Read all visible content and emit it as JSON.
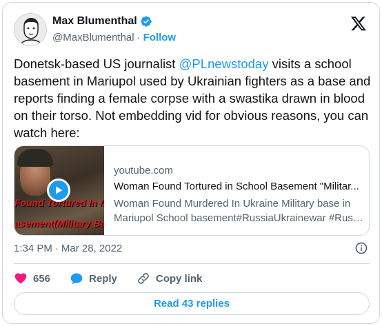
{
  "author": {
    "name": "Max Blumenthal",
    "handle": "@MaxBlumenthal",
    "separator": "·",
    "follow_label": "Follow"
  },
  "tweet": {
    "text_before": "Donetsk-based US journalist ",
    "mention": "@PLnewstoday",
    "text_after": " visits a school basement in Mariupol used by Ukrainian fighters as a base and reports finding a female corpse with a swastika drawn in blood on their torso. Not embedding vid for obvious reasons, you can watch here:"
  },
  "link_card": {
    "domain": "youtube.com",
    "title": "Woman Found Tortured in School Basement \"Militar...",
    "description_line1": "Woman Found Murdered In Ukraine Military base in",
    "description_line2": "Mariupol School basement#RussiaUkrainewar #Russi...",
    "thumbnail_text_1": "Found Tortured In Mariu",
    "thumbnail_text_2": "asement(Military Base)"
  },
  "meta": {
    "time": "1:34 PM",
    "separator": "·",
    "date": "Mar 28, 2022"
  },
  "actions": {
    "like_count": "656",
    "reply_label": "Reply",
    "copy_link_label": "Copy link"
  },
  "read_replies_label": "Read 43 replies",
  "colors": {
    "accent": "#1d9bf0",
    "like": "#f91880",
    "text": "#0f1419",
    "muted": "#536471",
    "border": "#cfd9de"
  },
  "icons": {
    "verified": "verified-badge-icon",
    "x_logo": "x-logo-icon",
    "play": "play-icon",
    "info": "info-icon",
    "heart": "heart-icon",
    "reply": "reply-bubble-icon",
    "link": "link-icon"
  }
}
